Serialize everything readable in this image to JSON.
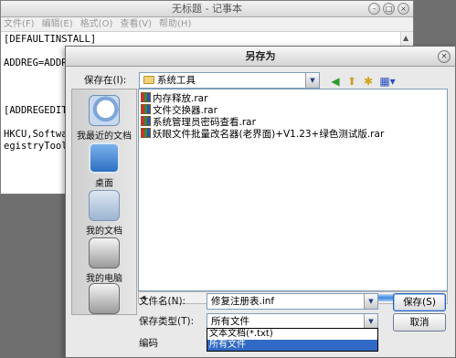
{
  "notepad": {
    "title": "无标题 - 记事本",
    "menu": [
      "文件(F)",
      "编辑(E)",
      "格式(O)",
      "查看(V)",
      "帮助(H)"
    ],
    "lines": [
      "[DEFAULTINSTALL]",
      "",
      "ADDREG=ADDRE",
      "",
      "",
      "",
      "[ADDREGEDIT]",
      "",
      "HKCU,Softwar",
      "egistryTools"
    ]
  },
  "dialog": {
    "title": "另存为",
    "save_in_label": "保存在(I):",
    "save_in_value": "系统工具",
    "toolbar_icons": [
      "back-icon",
      "up-folder-icon",
      "new-folder-icon",
      "view-menu-icon"
    ],
    "places": [
      {
        "label": "我最近的文档",
        "icon": "recent-documents-icon"
      },
      {
        "label": "桌面",
        "icon": "desktop-icon"
      },
      {
        "label": "我的文档",
        "icon": "my-documents-icon"
      },
      {
        "label": "我的电脑",
        "icon": "my-computer-icon"
      },
      {
        "label": "",
        "icon": "network-places-icon"
      }
    ],
    "files": [
      "内存释放.rar",
      "文件交换器.rar",
      "系统管理员密码查看.rar",
      "妖眼文件批量改名器(老界面)+V1.23+绿色测试版.rar"
    ],
    "filename_label": "文件名(N):",
    "filename_value": "修复注册表.inf",
    "filetype_label": "保存类型(T):",
    "filetype_value": "所有文件",
    "encoding_label": "编码",
    "filetype_options": [
      "文本文档(*.txt)",
      "所有文件"
    ],
    "selected_option": "所有文件",
    "save_button": "保存(S)",
    "cancel_button": "取消"
  },
  "colors": {
    "accent": "#316ac5",
    "field_border": "#7f9db9"
  }
}
